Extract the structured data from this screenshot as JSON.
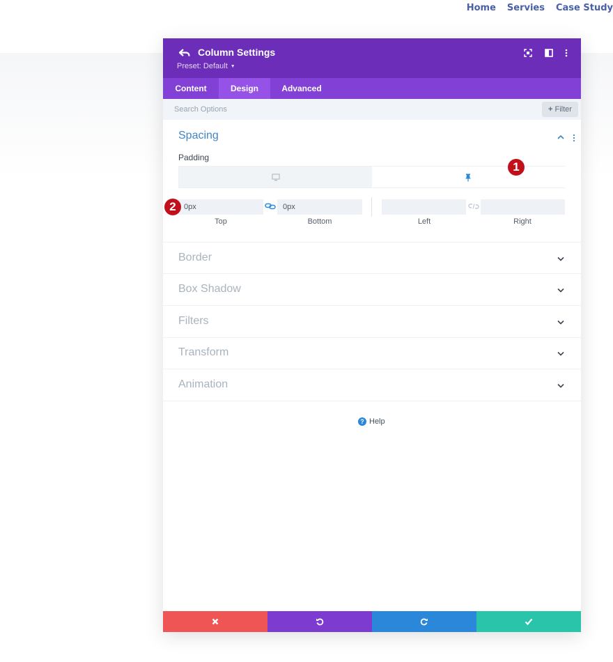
{
  "site_nav": {
    "items": [
      "Home",
      "Servies",
      "Case Study"
    ],
    "color": "#4960a8"
  },
  "modal": {
    "title": "Column Settings",
    "preset": "Preset: Default",
    "header_color": "#6c2eb9",
    "header_icons": [
      "fullscreen-icon",
      "split-view-icon",
      "more-vertical-icon"
    ],
    "tabs": [
      {
        "label": "Content",
        "active": false
      },
      {
        "label": "Design",
        "active": true
      },
      {
        "label": "Advanced",
        "active": false
      }
    ],
    "search": {
      "placeholder": "Search Options"
    },
    "filter_label": "Filter",
    "spacing": {
      "title": "Spacing",
      "padding_label": "Padding",
      "devices": [
        "desktop-icon",
        "pin-icon"
      ],
      "fields": [
        {
          "caption": "Top",
          "value": "0px"
        },
        {
          "caption": "Bottom",
          "value": "0px"
        },
        {
          "caption": "Left",
          "value": ""
        },
        {
          "caption": "Right",
          "value": ""
        }
      ]
    },
    "groups": [
      "Border",
      "Box Shadow",
      "Filters",
      "Transform",
      "Animation"
    ],
    "help_label": "Help",
    "footer_buttons": [
      {
        "name": "discard",
        "icon": "close-icon",
        "color": "#ef5555"
      },
      {
        "name": "undo",
        "icon": "undo-icon",
        "color": "#7d3bcf"
      },
      {
        "name": "redo",
        "icon": "redo-icon",
        "color": "#2b87da"
      },
      {
        "name": "save",
        "icon": "check-icon",
        "color": "#29c4a9"
      }
    ]
  },
  "annotations": {
    "badge_1": "1",
    "badge_2": "2",
    "badge_color": "#c1101c"
  }
}
